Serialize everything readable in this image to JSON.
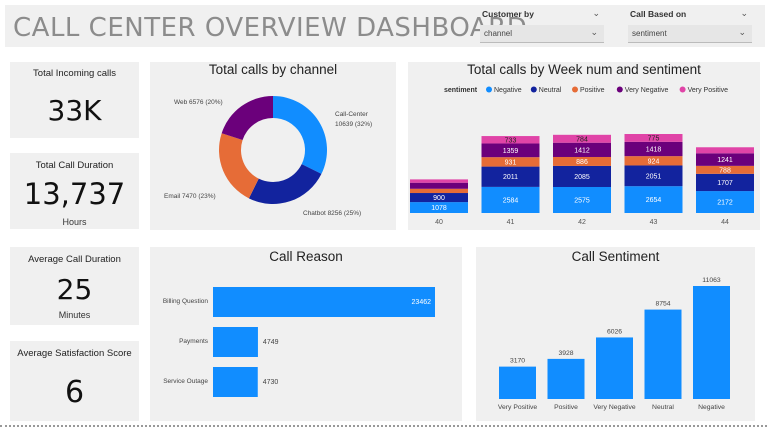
{
  "header": {
    "title": "CALL CENTER OVERVIEW DASHBOARD"
  },
  "slicers": [
    {
      "label": "Customer by",
      "value": "channel"
    },
    {
      "label": "Call Based on",
      "value": "sentiment"
    }
  ],
  "kpis": {
    "incoming": {
      "label": "Total Incoming calls",
      "value": "33K"
    },
    "duration": {
      "label": "Total Call Duration",
      "value": "13,737",
      "unit": "Hours"
    },
    "avg_duration": {
      "label": "Average Call Duration",
      "value": "25",
      "unit": "Minutes"
    },
    "satisfaction": {
      "label": "Average Satisfaction Score",
      "value": "6"
    }
  },
  "colors": {
    "negative": "#118dff",
    "neutral": "#12239e",
    "positive": "#e66c37",
    "very_negative": "#6b007b",
    "very_positive": "#e044a7",
    "panel": "#f0f0f0"
  },
  "chart_data": [
    {
      "id": "channel",
      "type": "pie",
      "title": "Total calls by channel",
      "slices": [
        {
          "name": "Call-Center",
          "value": 10639,
          "label": "Call-Center 10639 (32%)",
          "color": "#118dff"
        },
        {
          "name": "Chatbot",
          "value": 8256,
          "label": "Chatbot 8256 (25%)",
          "color": "#12239e"
        },
        {
          "name": "Email",
          "value": 7470,
          "label": "Email 7470 (23%)",
          "color": "#e66c37"
        },
        {
          "name": "Web",
          "value": 6576,
          "label": "Web 6576 (20%)",
          "color": "#6b007b"
        }
      ]
    },
    {
      "id": "week_sentiment",
      "type": "bar",
      "stacked": true,
      "title": "Total calls by Week num and sentiment",
      "legend_title": "sentiment",
      "legend_position": "top",
      "categories": [
        "40",
        "41",
        "42",
        "43",
        "44"
      ],
      "series": [
        {
          "name": "Negative",
          "color": "#118dff",
          "values": [
            1078,
            2584,
            2575,
            2654,
            2172
          ]
        },
        {
          "name": "Neutral",
          "color": "#12239e",
          "values": [
            900,
            2011,
            2085,
            2051,
            1707
          ]
        },
        {
          "name": "Positive",
          "color": "#e66c37",
          "values": [
            420,
            931,
            886,
            924,
            788
          ]
        },
        {
          "name": "Very Negative",
          "color": "#6b007b",
          "values": [
            600,
            1359,
            1412,
            1418,
            1241
          ]
        },
        {
          "name": "Very Positive",
          "color": "#e044a7",
          "values": [
            330,
            733,
            784,
            775,
            600
          ]
        }
      ],
      "printed_labels": [
        [
          "1078",
          "900",
          "",
          "",
          ""
        ],
        [
          "2584",
          "2011",
          "931",
          "1359",
          "733"
        ],
        [
          "2575",
          "2085",
          "886",
          "1412",
          "784"
        ],
        [
          "2654",
          "2051",
          "924",
          "1418",
          "775"
        ],
        [
          "2172",
          "1707",
          "788",
          "1241",
          ""
        ]
      ]
    },
    {
      "id": "reason",
      "type": "bar",
      "orientation": "horizontal",
      "title": "Call Reason",
      "categories": [
        "Billing Question",
        "Payments",
        "Service Outage"
      ],
      "values": [
        23462,
        4749,
        4730
      ],
      "color": "#118dff"
    },
    {
      "id": "sentiment",
      "type": "bar",
      "title": "Call Sentiment",
      "categories": [
        "Very Positive",
        "Positive",
        "Very Negative",
        "Neutral",
        "Negative"
      ],
      "values": [
        3170,
        3928,
        6026,
        8754,
        11063
      ],
      "color": "#118dff"
    }
  ]
}
